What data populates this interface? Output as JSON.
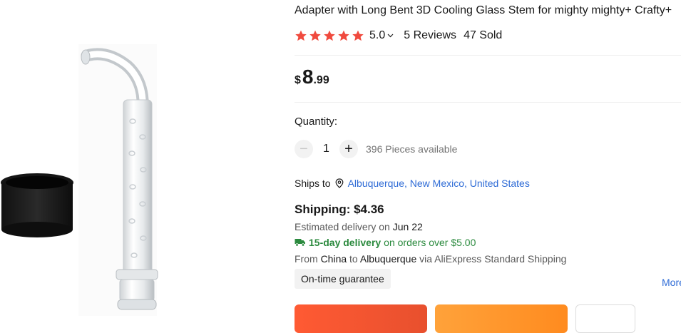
{
  "product": {
    "title": "Adapter with Long Bent 3D Cooling Glass Stem for mighty mighty+ Crafty+",
    "rating": "5.0",
    "reviews": "5 Reviews",
    "sold": "47 Sold",
    "star_count": 5,
    "star_color": "#f04a3e"
  },
  "price": {
    "currency": "$",
    "integer": "8",
    "decimal": ".99"
  },
  "quantity": {
    "label": "Quantity:",
    "minus": "−",
    "plus": "+",
    "value": "1",
    "available": "396 Pieces available"
  },
  "shipping": {
    "ships_to_label": "Ships to",
    "location": "Albuquerque, New Mexico, United States",
    "price_text": "Shipping: $4.36",
    "estimated_prefix": "Estimated delivery on",
    "estimated_date": "Jun 22",
    "fast_delivery": "15-day delivery",
    "fast_condition": "on orders over $5.00",
    "from_label": "From",
    "from_country": "China",
    "to_label": "to",
    "to_city": "Albuquerque",
    "via_text": "via AliExpress Standard Shipping",
    "guarantee": "On-time guarantee",
    "more": "More"
  },
  "icons": {
    "star": "star-icon",
    "chevron": "chevron-down-icon",
    "pin": "location-pin-icon",
    "truck": "truck-icon"
  },
  "colors": {
    "link": "#2e6bd6",
    "green": "#2b8a3e",
    "buy_button": "#ff5a33",
    "cart_button": "#ffa23a"
  }
}
